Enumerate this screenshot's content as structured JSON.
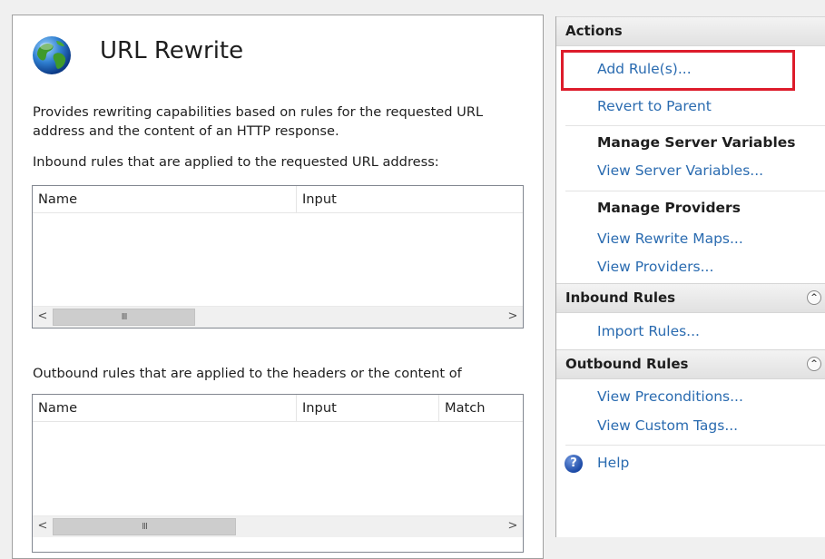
{
  "feature": {
    "title": "URL Rewrite",
    "description": "Provides rewriting capabilities based on rules for the requested URL address and the content of an HTTP response.",
    "icon": "globe-icon",
    "inbound": {
      "label": "Inbound rules that are applied to the requested URL address:",
      "columns": [
        "Name",
        "Input"
      ]
    },
    "outbound": {
      "label": "Outbound rules that are applied to the headers or the content of",
      "columns": [
        "Name",
        "Input",
        "Match"
      ]
    },
    "scroll": {
      "left": "<",
      "right": ">",
      "grip": "III"
    }
  },
  "actions": {
    "header": "Actions",
    "add_rules": "Add Rule(s)...",
    "revert_to_parent": "Revert to Parent",
    "manage_server_variables": "Manage Server Variables",
    "view_server_variables": "View Server Variables...",
    "manage_providers": "Manage Providers",
    "view_rewrite_maps": "View Rewrite Maps...",
    "view_providers": "View Providers...",
    "inbound_rules_header": "Inbound Rules",
    "import_rules": "Import Rules...",
    "outbound_rules_header": "Outbound Rules",
    "view_preconditions": "View Preconditions...",
    "view_custom_tags": "View Custom Tags...",
    "help": "Help",
    "collapse_glyph": "^"
  },
  "colors": {
    "link": "#2a6bb0",
    "highlight": "#dd1c2b",
    "header_bg": "#e6e6e6"
  }
}
